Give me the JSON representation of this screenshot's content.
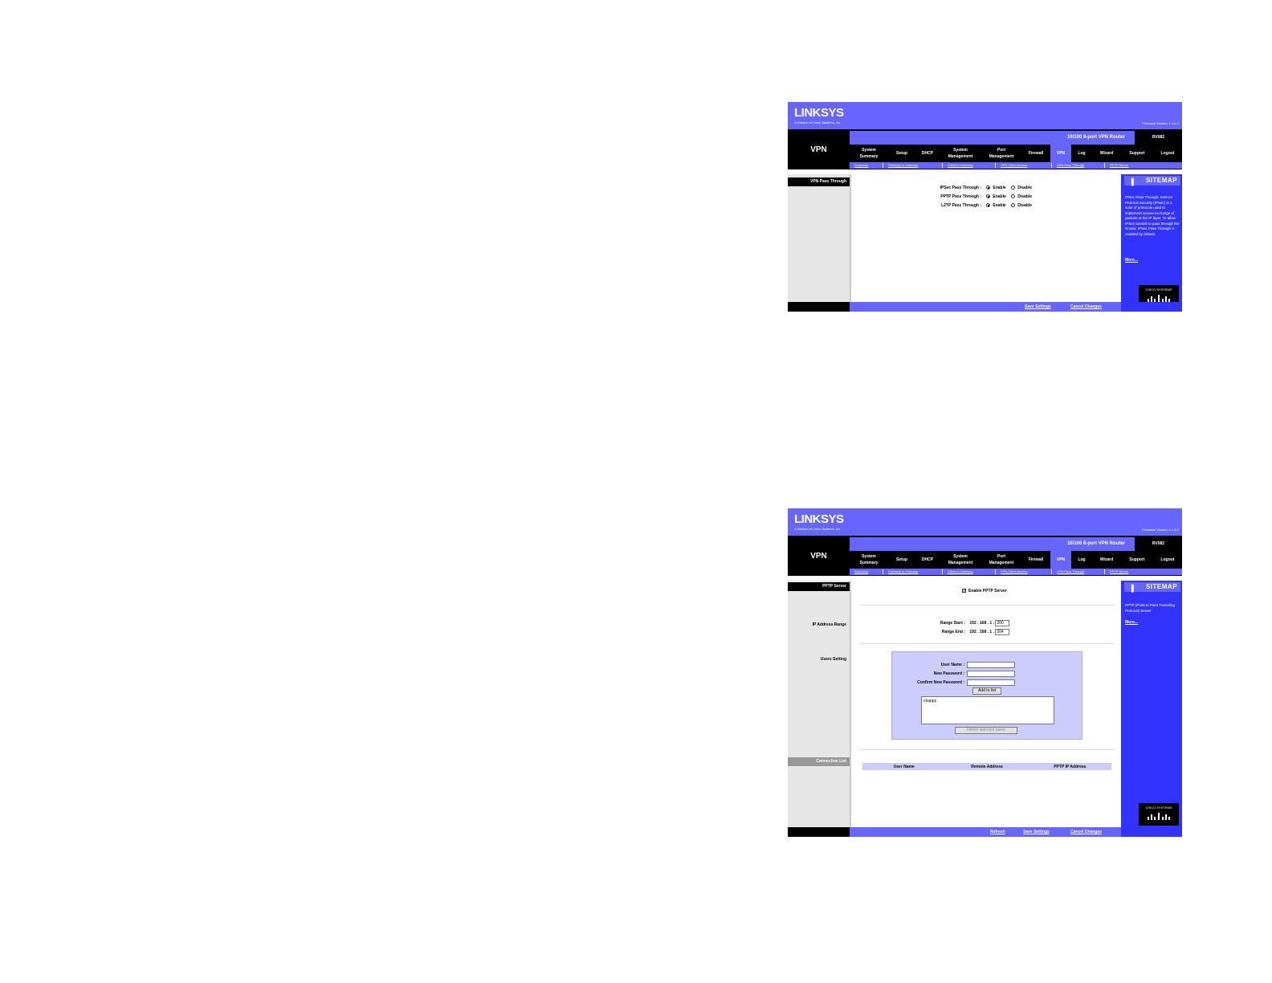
{
  "header": {
    "logo": "LINKSYS",
    "logo_sub": "A Division of Cisco Systems, Inc.",
    "firmware": "Firmware Version: 1.1.6.2",
    "product": "10/100 8-port VPN Router",
    "model": "RV082",
    "section_title": "VPN"
  },
  "tabs": [
    {
      "label": "System\nSummary"
    },
    {
      "label": "Setup"
    },
    {
      "label": "DHCP"
    },
    {
      "label": "System\nManagement"
    },
    {
      "label": "Port\nManagement"
    },
    {
      "label": "Firewall"
    },
    {
      "label": "VPN"
    },
    {
      "label": "Log"
    },
    {
      "label": "Wizard"
    },
    {
      "label": "Support"
    },
    {
      "label": "Logout"
    }
  ],
  "subtabs": [
    {
      "label": "Summary"
    },
    {
      "label": "Gateway to Gateway"
    },
    {
      "label": "Client to Gateway"
    },
    {
      "label": "VPN Client Access"
    },
    {
      "label": "VPN Pass Through"
    },
    {
      "label": "PPTP Server"
    }
  ],
  "panel1": {
    "left_heading": "VPN Pass Through",
    "rows": [
      {
        "label": "IPSec Pass Through :",
        "enable": "Enable",
        "disable": "Disable"
      },
      {
        "label": "PPTP Pass Through :",
        "enable": "Enable",
        "disable": "Disable"
      },
      {
        "label": "L2TP Pass Through :",
        "enable": "Enable",
        "disable": "Disable"
      }
    ],
    "sitemap": "SITEMAP",
    "help_text": "IPSec Pass Through: Internet Protocol Security (IPSec) is a suite of protocols used to implement secure exchange of packets at the IP layer. To allow IPSec tunnels to pass through the Router, IPSec Pass Through is enabled by default.",
    "more": "More...",
    "cisco": "CISCO SYSTEMS",
    "save": "Save Settings",
    "cancel": "Cancel Changes"
  },
  "panel2": {
    "left_heading": "PPTP Server",
    "ip_range_label": "IP Address Range",
    "users_label": "Users Setting",
    "conn_heading": "Connection List",
    "enable_label": "Enable PPTP Server",
    "range_start_label": "Range Start :",
    "range_end_label": "Range End :",
    "ip_prefix": "192 . 168 . 1 .",
    "range_start": "200",
    "range_end": "204",
    "user_name_label": "User Name :",
    "new_password_label": "New Password :",
    "confirm_password_label": "Confirm New Password :",
    "add_button": "Add to list",
    "user_list": [
      "chappy"
    ],
    "delete_button": "Delete selected users",
    "conn_columns": [
      "User Name",
      "Remote Address",
      "PPTP IP Address"
    ],
    "sitemap": "SITEMAP",
    "help_text": "PPTP (Point to Point Tunneling Protocol) Server",
    "more": "More...",
    "cisco": "CISCO SYSTEMS",
    "refresh": "Refresh",
    "save": "Save Settings",
    "cancel": "Cancel Changes"
  }
}
